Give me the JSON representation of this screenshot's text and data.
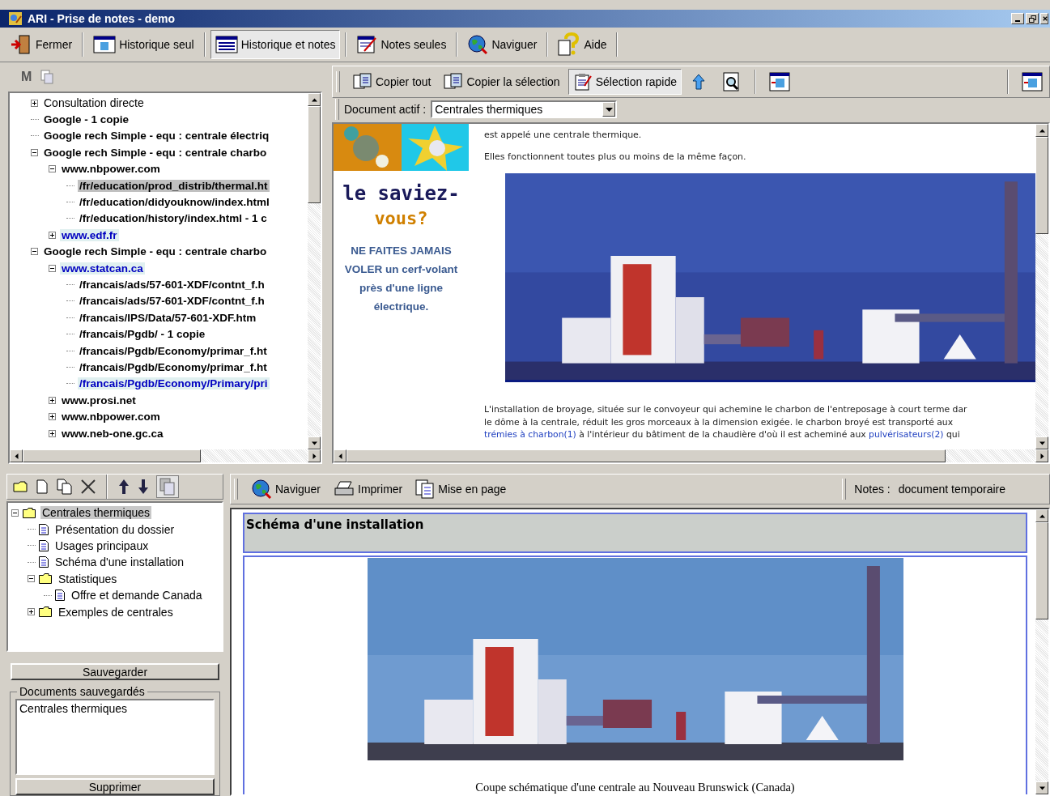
{
  "window": {
    "title": "ARI - Prise de notes - demo"
  },
  "toolbar": [
    {
      "label": "Fermer",
      "selected": false
    },
    {
      "label": "Historique seul",
      "selected": false
    },
    {
      "label": "Historique et notes",
      "selected": true
    },
    {
      "label": "Notes seules",
      "selected": false
    },
    {
      "label": "Naviguer",
      "selected": false
    },
    {
      "label": "Aide",
      "selected": false
    }
  ],
  "history_panel": {
    "header_label": "M",
    "tree": [
      {
        "label": "Consultation directe",
        "bold": false,
        "selected": false,
        "highlighted": false,
        "expanded": false
      },
      {
        "label": "Google - 1 copie",
        "bold": true,
        "selected": false,
        "highlighted": false
      },
      {
        "label": "Google rech Simple - equ : centrale électriq",
        "bold": true,
        "selected": false,
        "highlighted": false
      },
      {
        "label": "Google rech Simple - equ : centrale charbo",
        "bold": true,
        "selected": false,
        "highlighted": false,
        "expanded": true,
        "children": [
          {
            "label": "www.nbpower.com",
            "bold": true,
            "selected": false,
            "highlighted": false,
            "expanded": true,
            "children": [
              {
                "label": "/fr/education/prod_distrib/thermal.ht",
                "bold": true,
                "selected": true,
                "highlighted": false
              },
              {
                "label": "/fr/education/didyouknow/index.html",
                "bold": true,
                "selected": false,
                "highlighted": false
              },
              {
                "label": "/fr/education/history/index.html - 1 c",
                "bold": true,
                "selected": false,
                "highlighted": false
              }
            ]
          },
          {
            "label": "www.edf.fr",
            "bold": true,
            "selected": false,
            "highlighted": true,
            "expanded": false
          }
        ]
      },
      {
        "label": "Google rech Simple - equ : centrale charbo",
        "bold": true,
        "selected": false,
        "highlighted": false,
        "expanded": true,
        "children": [
          {
            "label": "www.statcan.ca",
            "bold": true,
            "selected": false,
            "highlighted": true,
            "expanded": true,
            "children": [
              {
                "label": "/francais/ads/57-601-XDF/contnt_f.h",
                "bold": true,
                "selected": false,
                "highlighted": false
              },
              {
                "label": "/francais/ads/57-601-XDF/contnt_f.h",
                "bold": true,
                "selected": false,
                "highlighted": false
              },
              {
                "label": "/francais/IPS/Data/57-601-XDF.htm",
                "bold": true,
                "selected": false,
                "highlighted": false
              },
              {
                "label": "/francais/Pgdb/ - 1 copie",
                "bold": true,
                "selected": false,
                "highlighted": false
              },
              {
                "label": "/francais/Pgdb/Economy/primar_f.ht",
                "bold": true,
                "selected": false,
                "highlighted": false
              },
              {
                "label": "/francais/Pgdb/Economy/primar_f.ht",
                "bold": true,
                "selected": false,
                "highlighted": false
              },
              {
                "label": "/francais/Pgdb/Economy/Primary/pri",
                "bold": true,
                "selected": false,
                "highlighted": true
              }
            ]
          },
          {
            "label": "www.prosi.net",
            "bold": true,
            "selected": false,
            "highlighted": false,
            "expanded": false
          },
          {
            "label": "www.nbpower.com",
            "bold": true,
            "selected": false,
            "highlighted": false,
            "expanded": false
          },
          {
            "label": "www.neb-one.gc.ca",
            "bold": true,
            "selected": false,
            "highlighted": false,
            "expanded": false
          }
        ]
      }
    ]
  },
  "browser_toolbar": {
    "buttons": [
      {
        "label": "Copier tout",
        "selected": false
      },
      {
        "label": "Copier la sélection",
        "selected": false
      },
      {
        "label": "Sélection rapide",
        "selected": true
      }
    ],
    "active_document": {
      "label": "Document actif :",
      "value": "Centrales thermiques"
    }
  },
  "web_page": {
    "sidebar": {
      "title_1": "le saviez-",
      "title_2": "vous?",
      "tip": "NE FAITES JAMAIS VOLER un cerf-volant près d'une ligne électrique."
    },
    "paragraphs": [
      "est appelé une centrale thermique.",
      "Elles fonctionnent toutes plus ou moins de la même façon."
    ],
    "long_paragraph": [
      [
        {
          "text": "L'installation de broyage, située sur le convoyeur qui achemine le charbon de l'entreposage à court terme dar",
          "link": false
        }
      ],
      [
        {
          "text": "le dôme à la centrale, réduit les gros morceaux à la dimension exigée. le charbon broyé est transporté aux",
          "link": false
        }
      ],
      [
        {
          "text": "trémies à charbon(1)",
          "link": true
        },
        {
          "text": " à l'intérieur du bâtiment de la chaudière d'où il est acheminé aux ",
          "link": false
        },
        {
          "text": "pulvérisateurs(2)",
          "link": true
        },
        {
          "text": " qui",
          "link": false
        }
      ]
    ]
  },
  "notes_panel": {
    "tree": [
      {
        "label": "Centrales thermiques",
        "kind": "folder",
        "selected": true,
        "expanded": true,
        "children": [
          {
            "label": "Présentation du dossier",
            "kind": "document",
            "selected": false
          },
          {
            "label": "Usages principaux",
            "kind": "document",
            "selected": false
          },
          {
            "label": "Schéma d'une installation",
            "kind": "document",
            "selected": false
          },
          {
            "label": "Statistiques",
            "kind": "folder",
            "selected": false,
            "expanded": true,
            "children": [
              {
                "label": "Offre et demande Canada",
                "kind": "document",
                "selected": false
              }
            ]
          },
          {
            "label": "Exemples de centrales",
            "kind": "folder",
            "selected": false,
            "expanded": false
          }
        ]
      }
    ],
    "save_button": "Sauvegarder",
    "saved_group": {
      "title": "Documents sauvegardés",
      "items": [
        "Centrales thermiques"
      ]
    },
    "delete_button": "Supprimer"
  },
  "notes_toolbar": {
    "buttons": [
      {
        "label": "Naviguer"
      },
      {
        "label": "Imprimer"
      },
      {
        "label": "Mise en page"
      }
    ],
    "notes_label": "Notes :",
    "notes_value": "document temporaire"
  },
  "note": {
    "heading": "Schéma d'une installation",
    "caption": "Coupe schématique d'une centrale au Nouveau Brunswick (Canada)"
  }
}
